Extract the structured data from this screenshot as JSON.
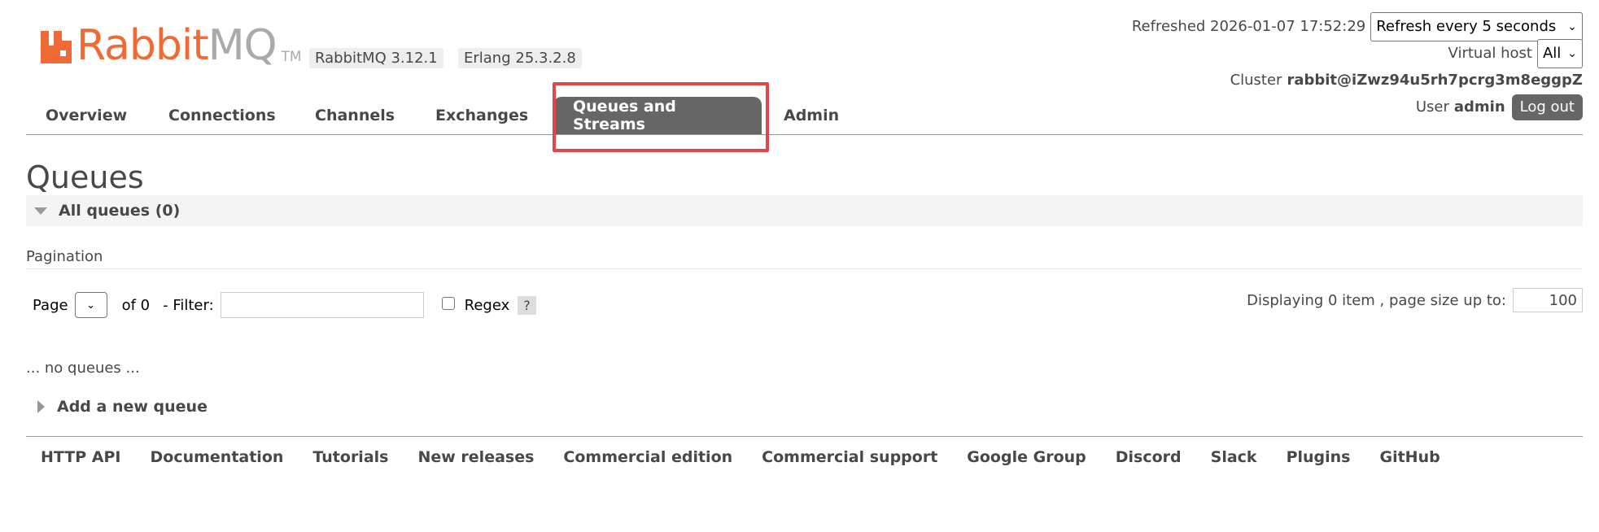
{
  "header": {
    "logo_text_rabbit": "Rabbit",
    "logo_text_mq": "MQ",
    "logo_tm": "TM",
    "version": "RabbitMQ 3.12.1",
    "erlang": "Erlang 25.3.2.8"
  },
  "status": {
    "refreshed_label": "Refreshed 2026-01-07 17:52:29",
    "refresh_select": "Refresh every 5 seconds",
    "vhost_label": "Virtual host",
    "vhost_select": "All",
    "cluster_label": "Cluster",
    "cluster_name": "rabbit@iZwz94u5rh7pcrg3m8eggpZ",
    "user_label": "User",
    "user_name": "admin",
    "logout_label": "Log out"
  },
  "nav": {
    "tabs": [
      {
        "label": "Overview"
      },
      {
        "label": "Connections"
      },
      {
        "label": "Channels"
      },
      {
        "label": "Exchanges"
      },
      {
        "label": "Queues and Streams"
      },
      {
        "label": "Admin"
      }
    ],
    "active_tab": "Queues and Streams"
  },
  "main": {
    "title": "Queues",
    "section_all": "All queues (0)",
    "pagination_label": "Pagination",
    "page_label": "Page",
    "of_label": "of 0",
    "filter_label": "- Filter:",
    "filter_value": "",
    "regex_label": "Regex",
    "help_label": "?",
    "display_label": "Displaying 0 item , page size up to:",
    "page_size": "100",
    "no_items": "... no queues ...",
    "add_queue": "Add a new queue"
  },
  "footer": {
    "links": [
      {
        "label": "HTTP API"
      },
      {
        "label": "Documentation"
      },
      {
        "label": "Tutorials"
      },
      {
        "label": "New releases"
      },
      {
        "label": "Commercial edition"
      },
      {
        "label": "Commercial support"
      },
      {
        "label": "Google Group"
      },
      {
        "label": "Discord"
      },
      {
        "label": "Slack"
      },
      {
        "label": "Plugins"
      },
      {
        "label": "GitHub"
      }
    ]
  },
  "colors": {
    "brand_orange": "#f06a35",
    "nav_active_bg": "#666666",
    "highlight_red": "#e2454a"
  }
}
